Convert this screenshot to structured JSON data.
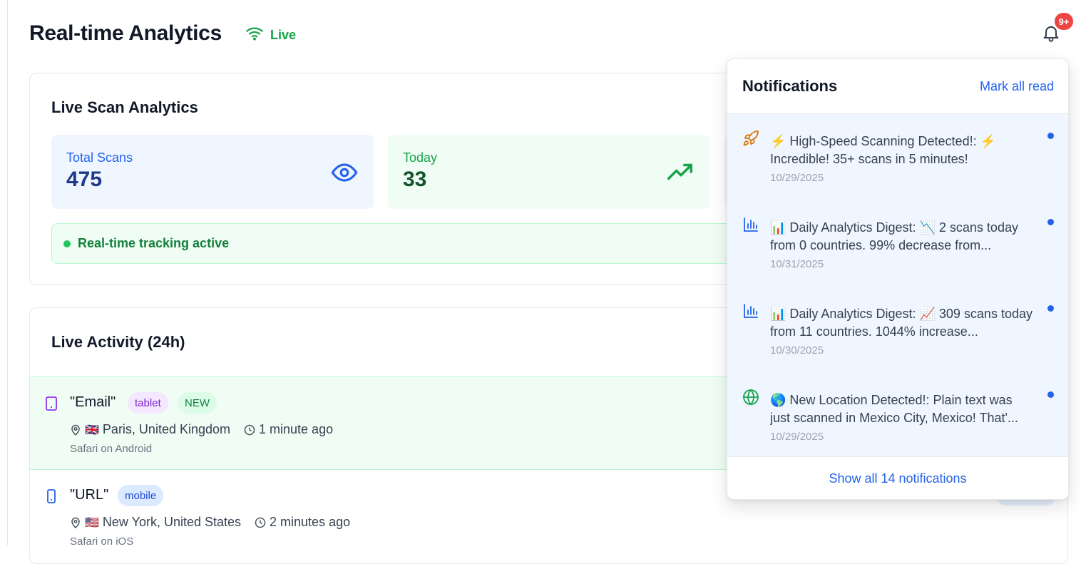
{
  "header": {
    "title": "Real-time Analytics",
    "live_label": "Live",
    "notification_badge": "9+"
  },
  "scan_card": {
    "title": "Live Scan Analytics",
    "stats": [
      {
        "label": "Total Scans",
        "value": "475",
        "icon": "eye-icon",
        "color": "#2563eb"
      },
      {
        "label": "Today",
        "value": "33",
        "icon": "trending-up-icon",
        "color": "#16a34a"
      }
    ],
    "tracking_text": "Real-time tracking active"
  },
  "activity": {
    "title": "Live Activity (24h)",
    "rows": [
      {
        "name": "\"Email\"",
        "device": "tablet",
        "new_badge": "NEW",
        "flag": "🇬🇧",
        "location": "Paris, United Kingdom",
        "time": "1 minute ago",
        "user_agent": "Safari on Android"
      },
      {
        "name": "\"URL\"",
        "device": "mobile",
        "flag": "🇺🇸",
        "location": "New York, United States",
        "time": "2 minutes ago",
        "user_agent": "Safari on iOS"
      }
    ]
  },
  "notifications": {
    "title": "Notifications",
    "mark_all_read": "Mark all read",
    "items": [
      {
        "icon": "rocket-icon",
        "text": "⚡ High-Speed Scanning Detected!: ⚡ Incredible! 35+ scans in 5 minutes!",
        "date": "10/29/2025",
        "unread": true
      },
      {
        "icon": "bar-chart-icon",
        "text": "📊 Daily Analytics Digest: 📉 2 scans today from 0 countries. 99% decrease from...",
        "date": "10/31/2025",
        "unread": true
      },
      {
        "icon": "bar-chart-icon",
        "text": "📊 Daily Analytics Digest: 📈 309 scans today from 11 countries. 1044% increase...",
        "date": "10/30/2025",
        "unread": true
      },
      {
        "icon": "globe-icon",
        "text": "🌎 New Location Detected!: Plain text was just scanned in Mexico City, Mexico! That'...",
        "date": "10/29/2025",
        "unread": true
      }
    ],
    "show_all": "Show all 14 notifications"
  },
  "colors": {
    "accent": "#2563eb",
    "success": "#16a34a",
    "danger": "#ef4444"
  }
}
